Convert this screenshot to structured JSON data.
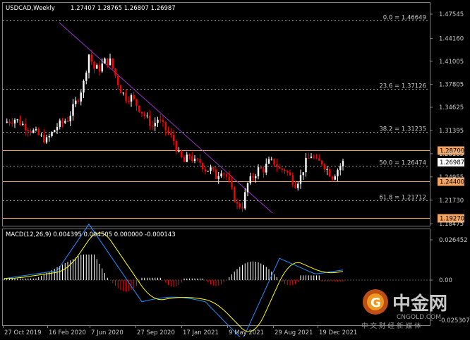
{
  "header": {
    "symbol_timeframe": "USDCAD,Weekly",
    "ohlc": "1.27407 1.28765 1.26807 1.26987"
  },
  "fib_levels": [
    {
      "label": "0.0 = 1.46649",
      "price": 1.46649
    },
    {
      "label": "23.6 = 1.37126",
      "price": 1.37126
    },
    {
      "label": "38.2 = 1.31235",
      "price": 1.31235
    },
    {
      "label": "50.0 = 1.26474",
      "price": 1.26474
    },
    {
      "label": "61.8 = 1.21712",
      "price": 1.21712
    }
  ],
  "hlines": [
    {
      "label": "1.28700",
      "price": 1.287,
      "color": "#f4a460"
    },
    {
      "label": "1.24400",
      "price": 1.244,
      "color": "#f4a460"
    },
    {
      "label": "1.19270",
      "price": 1.1927,
      "color": "#f4a460"
    }
  ],
  "price_axis": [
    "1.47545",
    "1.44160",
    "1.41005",
    "1.37805",
    "1.34625",
    "1.31395",
    "1.28185",
    "1.24955",
    "1.21730",
    "1.18475"
  ],
  "current_price": "1.26987",
  "x_axis": [
    "27 Oct 2019",
    "16 Feb 2020",
    "7 Jun 2020",
    "27 Sep 2020",
    "17 Jan 2021",
    "9 May 2021",
    "29 Aug 2021",
    "19 Dec 2021"
  ],
  "macd": {
    "title": "MACD(12,26,9) 0.004395 0.004505 0.000000 -0.000143",
    "axis": [
      "0.026452",
      "0.00",
      "-0.025307"
    ]
  },
  "watermark": {
    "brand": "中金网",
    "domain": "CNGOLD.COM",
    "slogan": "中 文 财 经 新 媒 体"
  },
  "colors": {
    "bull": "#ffffff",
    "bear": "#ff0000",
    "trendline": "#9932cc",
    "level": "#f4a460",
    "macd_line": "#1e90ff",
    "signal_line": "#ffff00",
    "grid": "#808080"
  },
  "chart_data": {
    "type": "candlestick",
    "symbol": "USDCAD",
    "timeframe": "Weekly",
    "price_range": [
      1.1848,
      1.4755
    ],
    "last": {
      "open": 1.27407,
      "high": 1.28765,
      "low": 1.26807,
      "close": 1.26987
    },
    "close_path": [
      [
        0,
        1.325
      ],
      [
        4,
        1.33
      ],
      [
        8,
        1.32
      ],
      [
        12,
        1.31
      ],
      [
        16,
        1.3
      ],
      [
        20,
        1.32
      ],
      [
        24,
        1.33
      ],
      [
        28,
        1.36
      ],
      [
        30,
        1.38
      ],
      [
        32,
        1.42
      ],
      [
        34,
        1.4
      ],
      [
        36,
        1.4
      ],
      [
        38,
        1.41
      ],
      [
        40,
        1.41
      ],
      [
        42,
        1.39
      ],
      [
        44,
        1.37
      ],
      [
        46,
        1.36
      ],
      [
        48,
        1.36
      ],
      [
        50,
        1.35
      ],
      [
        52,
        1.34
      ],
      [
        54,
        1.33
      ],
      [
        56,
        1.32
      ],
      [
        58,
        1.33
      ],
      [
        60,
        1.32
      ],
      [
        62,
        1.31
      ],
      [
        64,
        1.3
      ],
      [
        66,
        1.28
      ],
      [
        68,
        1.27
      ],
      [
        70,
        1.28
      ],
      [
        72,
        1.27
      ],
      [
        74,
        1.27
      ],
      [
        76,
        1.26
      ],
      [
        78,
        1.26
      ],
      [
        80,
        1.25
      ],
      [
        82,
        1.26
      ],
      [
        84,
        1.25
      ],
      [
        86,
        1.23
      ],
      [
        88,
        1.21
      ],
      [
        90,
        1.21
      ],
      [
        92,
        1.24
      ],
      [
        94,
        1.25
      ],
      [
        96,
        1.26
      ],
      [
        98,
        1.26
      ],
      [
        100,
        1.27
      ],
      [
        102,
        1.27
      ],
      [
        104,
        1.26
      ],
      [
        106,
        1.26
      ],
      [
        108,
        1.25
      ],
      [
        110,
        1.24
      ],
      [
        112,
        1.25
      ],
      [
        114,
        1.27
      ],
      [
        116,
        1.28
      ],
      [
        118,
        1.27
      ],
      [
        120,
        1.27
      ],
      [
        122,
        1.26
      ],
      [
        124,
        1.25
      ],
      [
        126,
        1.26
      ],
      [
        128,
        1.27
      ]
    ],
    "macd_histogram_sign": "positive early 2020, negative mid 2020, small mixed late 2020, negative early 2021, positive mid 2021, mixed late 2021"
  }
}
